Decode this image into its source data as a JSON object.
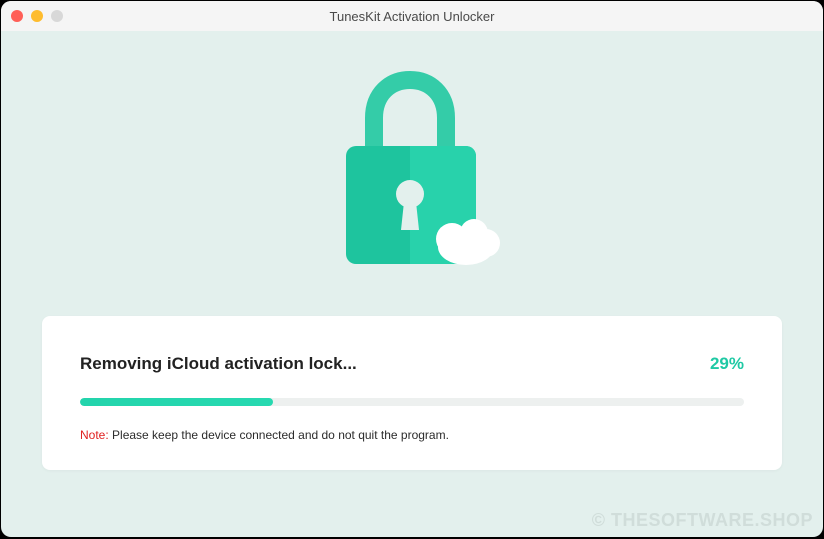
{
  "window": {
    "title": "TunesKit Activation Unlocker"
  },
  "progress": {
    "title": "Removing iCloud activation lock...",
    "percent_label": "29%",
    "percent_value": 29
  },
  "note": {
    "label": "Note:",
    "text": " Please keep the device connected and do not quit the program."
  },
  "watermark": "© THESOFTWARE.SHOP",
  "colors": {
    "accent": "#1fc9a4",
    "background": "#e3f0ed",
    "note_label": "#e02020"
  }
}
